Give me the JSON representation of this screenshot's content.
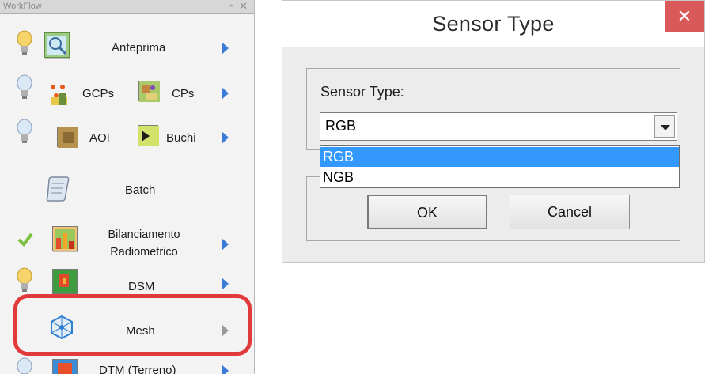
{
  "panel": {
    "title": "WorkFlow",
    "pin_glyph": "ₕ",
    "close_glyph": "✕",
    "items": [
      {
        "label": "Anteprima"
      },
      {
        "label": "GCPs",
        "label2": "CPs"
      },
      {
        "label": "AOI",
        "label2": "Buchi"
      },
      {
        "label": "Batch"
      },
      {
        "label": "Bilanciamento\nRadiometrico"
      },
      {
        "label": "DSM"
      },
      {
        "label": "Mesh"
      },
      {
        "label": "DTM (Terreno)"
      }
    ]
  },
  "dialog": {
    "title": "Sensor Type",
    "close_glyph": "✕",
    "group_label": "Sensor Type:",
    "combo_value": "RGB",
    "options": [
      "RGB",
      "NGB"
    ],
    "ok_label": "OK",
    "cancel_label": "Cancel"
  },
  "colors": {
    "highlight": "#e23a3a",
    "selection": "#3399ff",
    "close_button": "#d95858"
  }
}
